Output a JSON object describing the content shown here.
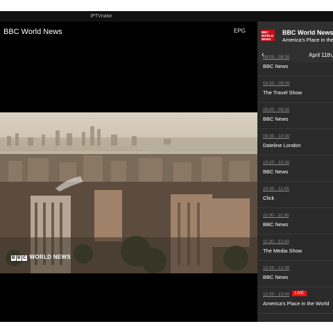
{
  "window": {
    "title": "IPTVnator"
  },
  "player": {
    "channel_title": "BBC World News",
    "epg_label": "EPG",
    "watermark_text": "WORLD NEWS",
    "watermark_letters": [
      "B",
      "B",
      "C"
    ],
    "live_label": "VE"
  },
  "sidebar": {
    "logo_text": "BBC WORLD NEWS",
    "channel_name": "BBC World News",
    "now_playing": "America's Place in the World",
    "date": "April 11th,",
    "programs": [
      {
        "time": "08:00 - 08:30",
        "title": "BBC News",
        "live": false
      },
      {
        "time": "08:30 - 09:00",
        "title": "The Travel Show",
        "live": false
      },
      {
        "time": "09:00 - 09:30",
        "title": "BBC News",
        "live": false
      },
      {
        "time": "09:30 - 10:00",
        "title": "Dateline London",
        "live": false
      },
      {
        "time": "10:00 - 10:30",
        "title": "BBC News",
        "live": false
      },
      {
        "time": "10:30 - 11:00",
        "title": "Click",
        "live": false
      },
      {
        "time": "11:00 - 11:30",
        "title": "BBC News",
        "live": false
      },
      {
        "time": "11:30 - 12:00",
        "title": "The Media Show",
        "live": false
      },
      {
        "time": "12:00 - 12:30",
        "title": "BBC News",
        "live": false
      },
      {
        "time": "12:30 - 13:00",
        "title": "America's Place in the World",
        "live": true,
        "live_label": "LIVE"
      }
    ]
  },
  "icons": {
    "back": "chevron-left-icon",
    "pip": "picture-in-picture-icon",
    "fullscreen": "fullscreen-icon"
  },
  "colors": {
    "live_badge": "#e11111",
    "logo_red": "#c4101b"
  }
}
